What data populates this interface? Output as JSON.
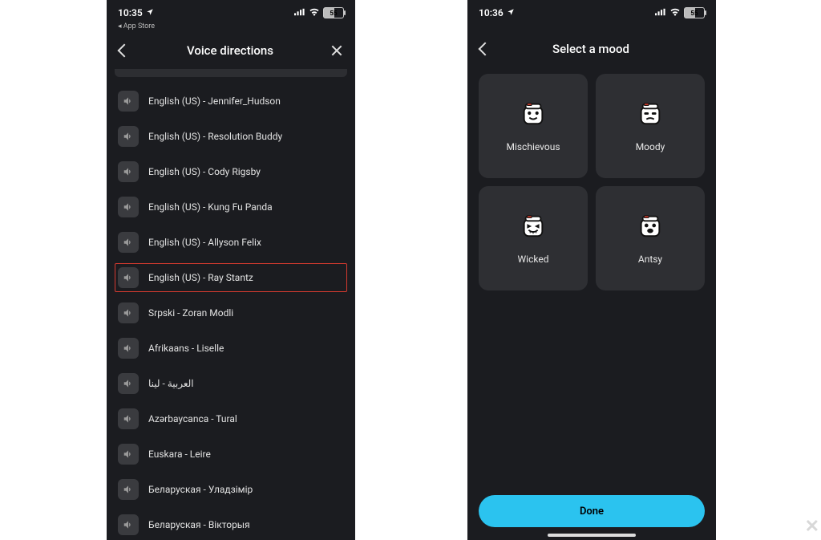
{
  "left": {
    "status": {
      "time": "10:35",
      "battery": "55"
    },
    "back_app": "App Store",
    "header": {
      "title": "Voice directions"
    },
    "voices": [
      {
        "label": "English (US) - Jennifer_Hudson",
        "highlight": false
      },
      {
        "label": "English (US) - Resolution Buddy",
        "highlight": false
      },
      {
        "label": "English (US) - Cody Rigsby",
        "highlight": false
      },
      {
        "label": "English (US) - Kung Fu Panda",
        "highlight": false
      },
      {
        "label": "English (US) - Allyson Felix",
        "highlight": false
      },
      {
        "label": "English (US) - Ray Stantz",
        "highlight": true
      },
      {
        "label": "Srpski - Zoran Modli",
        "highlight": false
      },
      {
        "label": "Afrikaans - Liselle",
        "highlight": false
      },
      {
        "label": "العربية - لينا",
        "highlight": false
      },
      {
        "label": "Azərbaycanca - Tural",
        "highlight": false
      },
      {
        "label": "Euskara - Leire",
        "highlight": false
      },
      {
        "label": "Беларуская - Уладзімір",
        "highlight": false
      },
      {
        "label": "Беларуская - Вікторыя",
        "highlight": false
      }
    ]
  },
  "right": {
    "status": {
      "time": "10:36",
      "battery": "55"
    },
    "header": {
      "title": "Select a mood"
    },
    "moods": [
      {
        "label": "Mischievous"
      },
      {
        "label": "Moody"
      },
      {
        "label": "Wicked"
      },
      {
        "label": "Antsy"
      }
    ],
    "done_label": "Done"
  }
}
